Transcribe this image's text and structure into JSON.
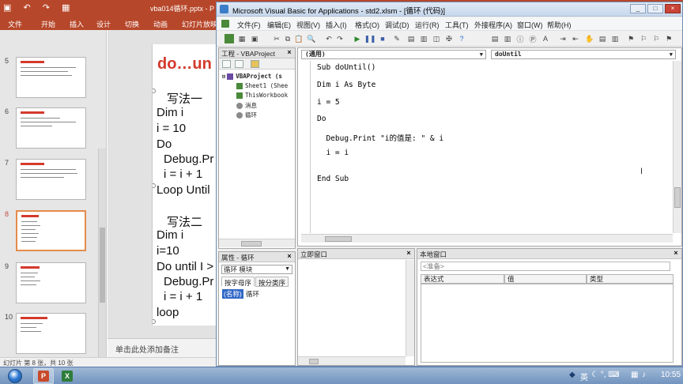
{
  "ppt": {
    "qat": "▣ ↶ ↷ ▦",
    "window_title": "vba014循环.pptx - P",
    "tabs": [
      "文件",
      "开始",
      "插入",
      "设计",
      "切换",
      "动画",
      "幻灯片放映"
    ],
    "thumbs": [
      {
        "num": "5",
        "active": false
      },
      {
        "num": "6",
        "active": false
      },
      {
        "num": "7",
        "active": false
      },
      {
        "num": "8",
        "active": true
      },
      {
        "num": "9",
        "active": false
      },
      {
        "num": "10",
        "active": false
      }
    ],
    "slide": {
      "title": "do…un",
      "lines": [
        "写法一",
        "Dim i",
        "i = 10",
        "Do",
        "Debug.Pr",
        "i = i + 1",
        "Loop Until",
        "写法二",
        "Dim i",
        "i=10",
        "Do until I >",
        "Debug.Pr",
        "i = i + 1",
        "loop"
      ]
    },
    "notes_placeholder": "单击此处添加备注",
    "status": "幻灯片 第 8 张，共 10 张"
  },
  "vbe": {
    "title": "Microsoft Visual Basic for Applications - std2.xlsm - [循环 (代码)]",
    "window_buttons": [
      "_",
      "□",
      "×"
    ],
    "menu": [
      "文件(F)",
      "编辑(E)",
      "视图(V)",
      "插入(I)",
      "格式(O)",
      "调试(D)",
      "运行(R)",
      "工具(T)",
      "外接程序(A)",
      "窗口(W)",
      "帮助(H)"
    ],
    "project": {
      "title": "工程 - VBAProject",
      "nodes": [
        {
          "label": "VBAProject (s",
          "indent": 0,
          "bold": true
        },
        {
          "label": "Sheet1 (Shee",
          "indent": 1,
          "bold": false
        },
        {
          "label": "ThisWorkbook",
          "indent": 1,
          "bold": false
        },
        {
          "label": "消息",
          "indent": 1,
          "bold": false
        },
        {
          "label": "循环",
          "indent": 1,
          "bold": false
        }
      ]
    },
    "properties": {
      "title": "属性 - 循环",
      "object": "循环 模块",
      "tab_alpha": "按字母序",
      "tab_category": "按分类序",
      "row_key": "(名称)",
      "row_value": "循环"
    },
    "code": {
      "object_combo": "(通用)",
      "proc_combo": "doUntil",
      "lines": [
        "Sub doUntil()",
        "Dim i As Byte",
        "i = 5",
        "Do",
        "  Debug.Print \"i的值是: \" & i",
        "  i = i",
        "End Sub"
      ]
    },
    "immediate": {
      "title": "立即窗口"
    },
    "locals": {
      "title": "本地窗口",
      "context": "<准备>",
      "columns": [
        "表达式",
        "值",
        "类型"
      ]
    }
  },
  "taskbar": {
    "lang": "英",
    "time": "10:55",
    "tray_icons": "☾ °, ⌨"
  },
  "colors": {
    "ppt_accent": "#b7472a",
    "keyword_blue": "#00008b",
    "slide_title_red": "#d33a2c",
    "selection_blue": "#3167c6"
  }
}
